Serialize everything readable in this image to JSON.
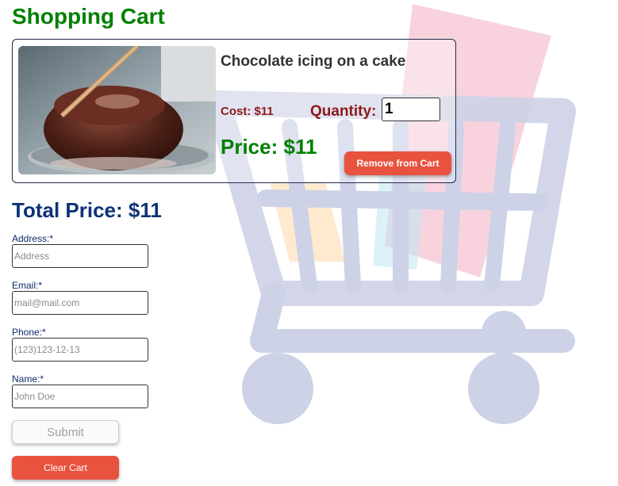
{
  "page": {
    "title": "Shopping Cart"
  },
  "cart_item": {
    "name": "Chocolate icing on a cake",
    "cost": "Cost: $11",
    "quantity_label": "Quantity:",
    "quantity_value": "1",
    "price": "Price: $11",
    "remove_label": "Remove from Cart"
  },
  "total": {
    "label": "Total Price: $11"
  },
  "form": {
    "address_label": "Address:*",
    "address_placeholder": "Address",
    "email_label": "Email:*",
    "email_placeholder": "mail@mail.com",
    "phone_label": "Phone:*",
    "phone_placeholder": "(123)123-12-13",
    "name_label": "Name:*",
    "name_placeholder": "John Doe",
    "submit_label": "Submit",
    "clear_label": "Clear Cart"
  },
  "colors": {
    "title_green": "#008000",
    "accent_red": "#e8523f",
    "total_blue": "#0d3275",
    "cost_red": "#8b1a1a"
  }
}
